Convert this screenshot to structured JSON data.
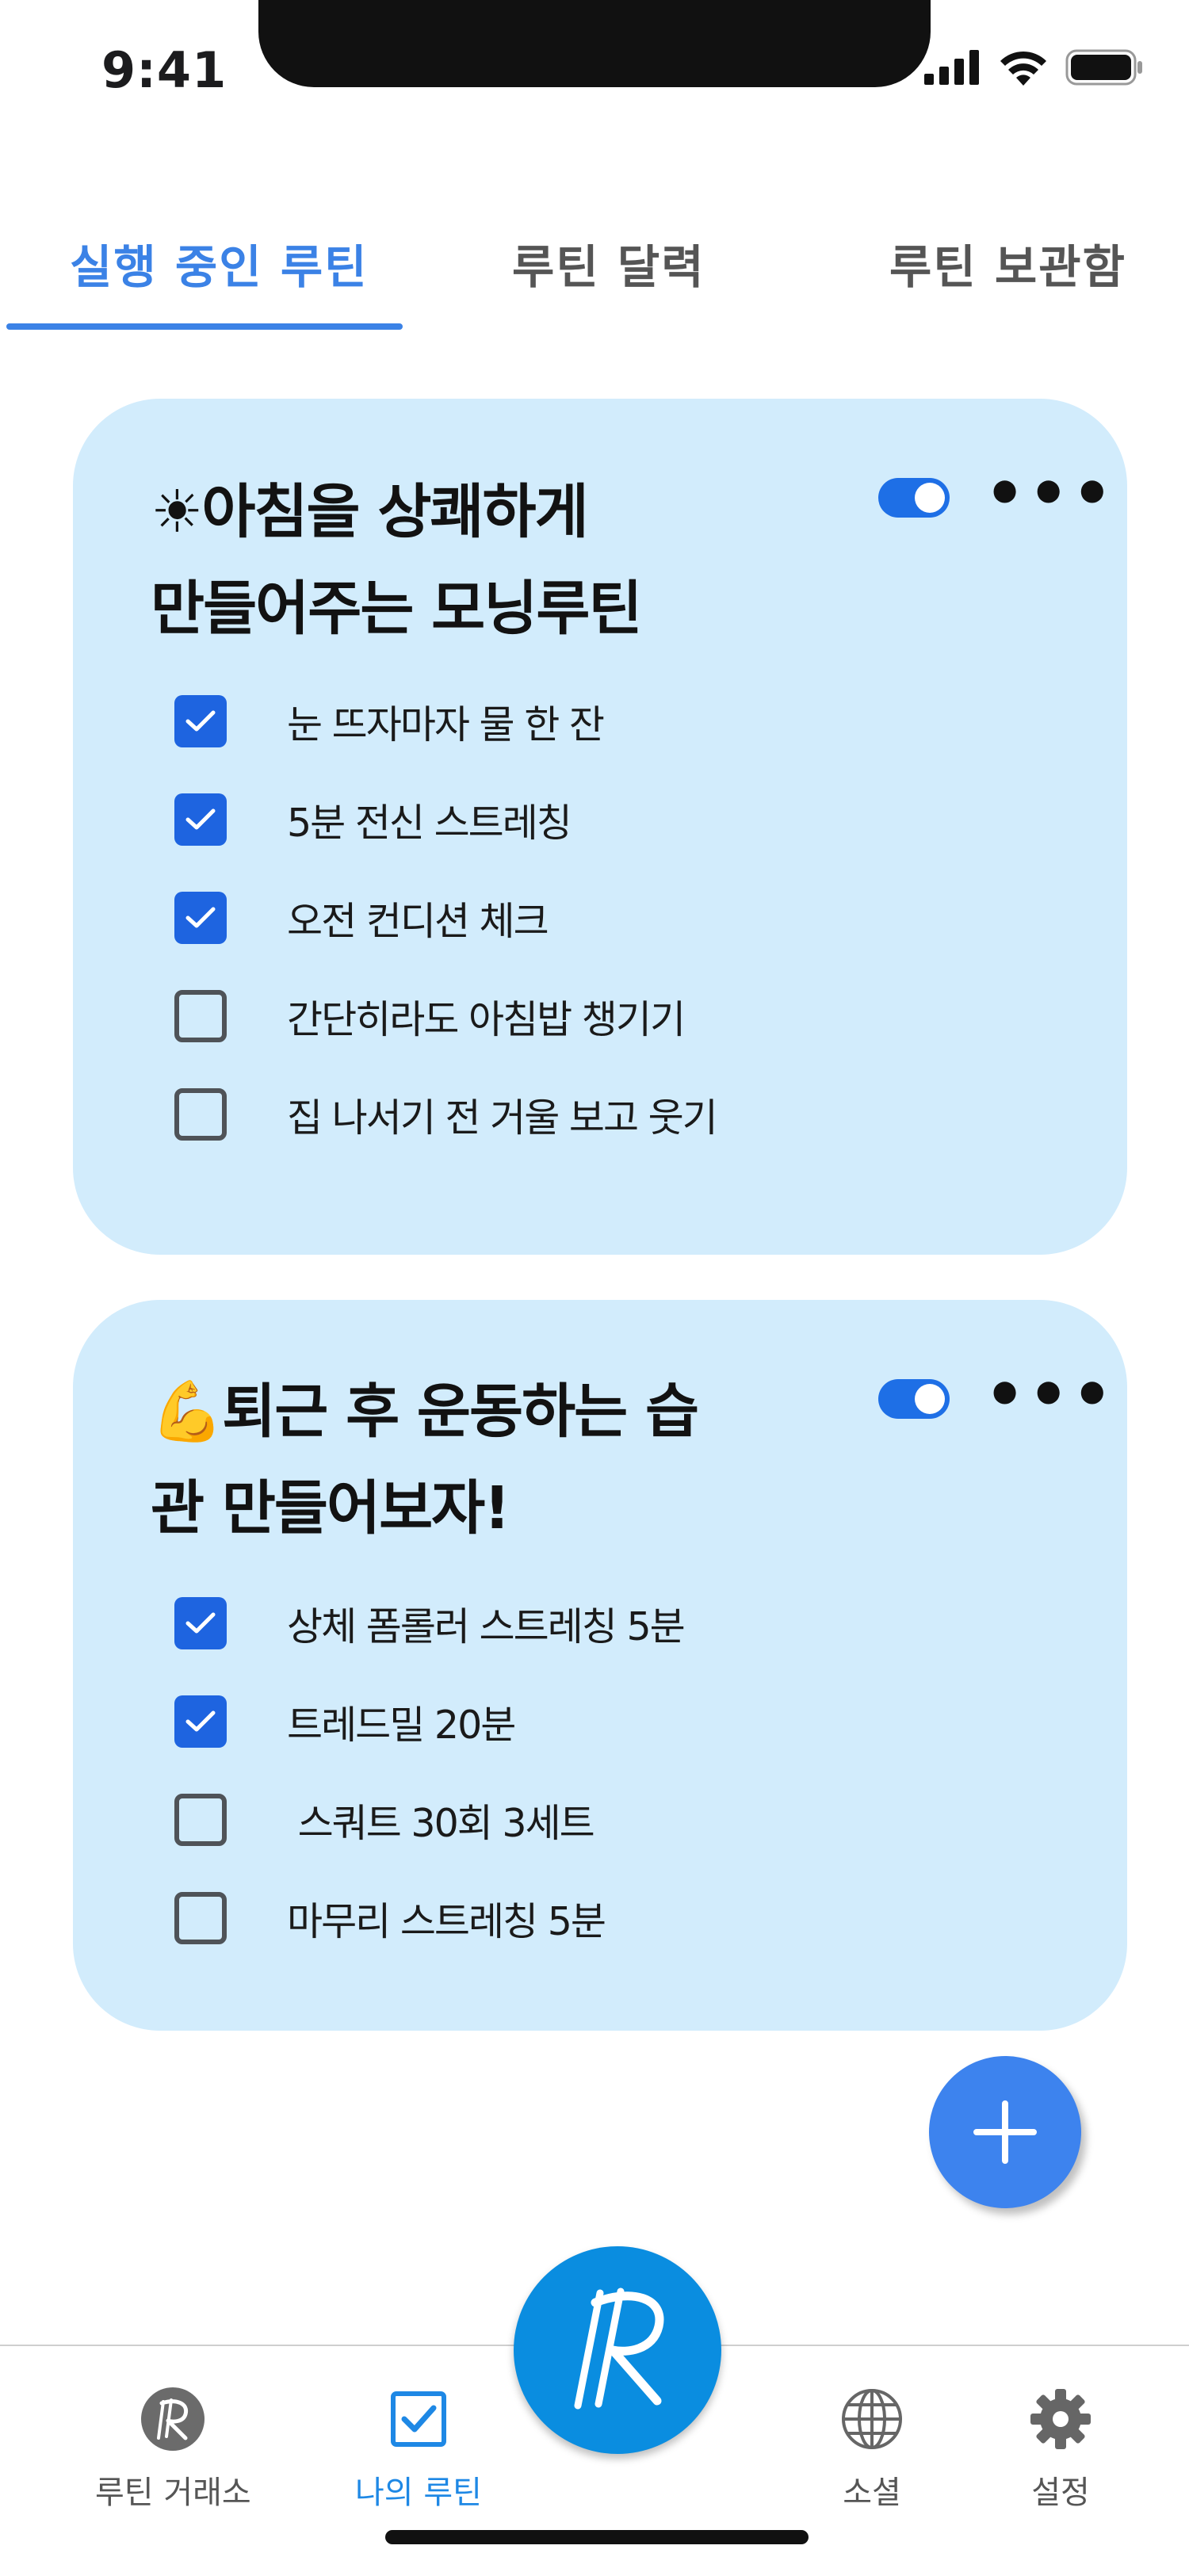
{
  "status_bar": {
    "time": "9:41"
  },
  "tabs": [
    {
      "label": "실행 중인 루틴",
      "active": true
    },
    {
      "label": "루틴 달력",
      "active": false
    },
    {
      "label": "루틴 보관함",
      "active": false
    }
  ],
  "routines": [
    {
      "emoji": "☀",
      "title_line1": "아침을 상쾌하게",
      "title_line2": "만들어주는 모닝루틴",
      "enabled": true,
      "tasks": [
        {
          "label": "눈 뜨자마자 물 한 잔",
          "checked": true
        },
        {
          "label": "5분 전신 스트레칭",
          "checked": true
        },
        {
          "label": "오전 컨디션 체크",
          "checked": true
        },
        {
          "label": "간단히라도 아침밥 챙기기",
          "checked": false
        },
        {
          "label": "집 나서기 전 거울 보고 웃기",
          "checked": false
        }
      ]
    },
    {
      "emoji": "💪",
      "title_line1": "퇴근 후 운동하는 습",
      "title_line2": "관 만들어보자!",
      "enabled": true,
      "tasks": [
        {
          "label": "상체 폼롤러 스트레칭 5분",
          "checked": true
        },
        {
          "label": "트레드밀 20분",
          "checked": true
        },
        {
          "label": " 스쿼트 30회 3세트",
          "checked": false
        },
        {
          "label": "마무리 스트레칭 5분",
          "checked": false
        }
      ]
    }
  ],
  "more_symbol": "•••",
  "bottom_nav": [
    {
      "label": "루틴 거래소",
      "icon": "routine-exchange-icon",
      "active": false
    },
    {
      "label": "나의 루틴",
      "icon": "checkbox-icon",
      "active": true
    },
    {
      "label": "소셜",
      "icon": "globe-icon",
      "active": false
    },
    {
      "label": "설정",
      "icon": "gear-icon",
      "active": false
    }
  ],
  "colors": {
    "accent": "#3b82e6",
    "card": "#d2ecfc",
    "check": "#1e64e0",
    "center_button": "#0a8de0"
  }
}
